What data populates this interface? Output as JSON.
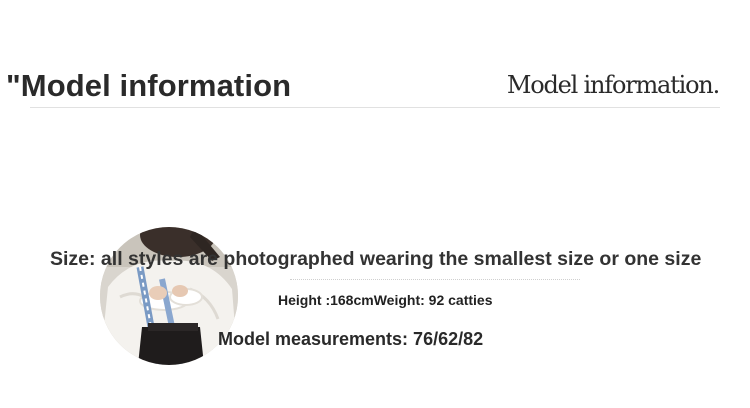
{
  "header": {
    "title": "\"Model information",
    "title_script": "Model information."
  },
  "model": {
    "photo_icon": "model-photo",
    "size_note": "Size: all styles are photographed wearing the smallest size or one size",
    "height": "Height :168cm",
    "weight": "Weight: 92 catties",
    "measurements": "Model measurements: 76/62/82"
  },
  "colors": {
    "text": "#2a2a2a",
    "rule": "#e1e1e1"
  }
}
